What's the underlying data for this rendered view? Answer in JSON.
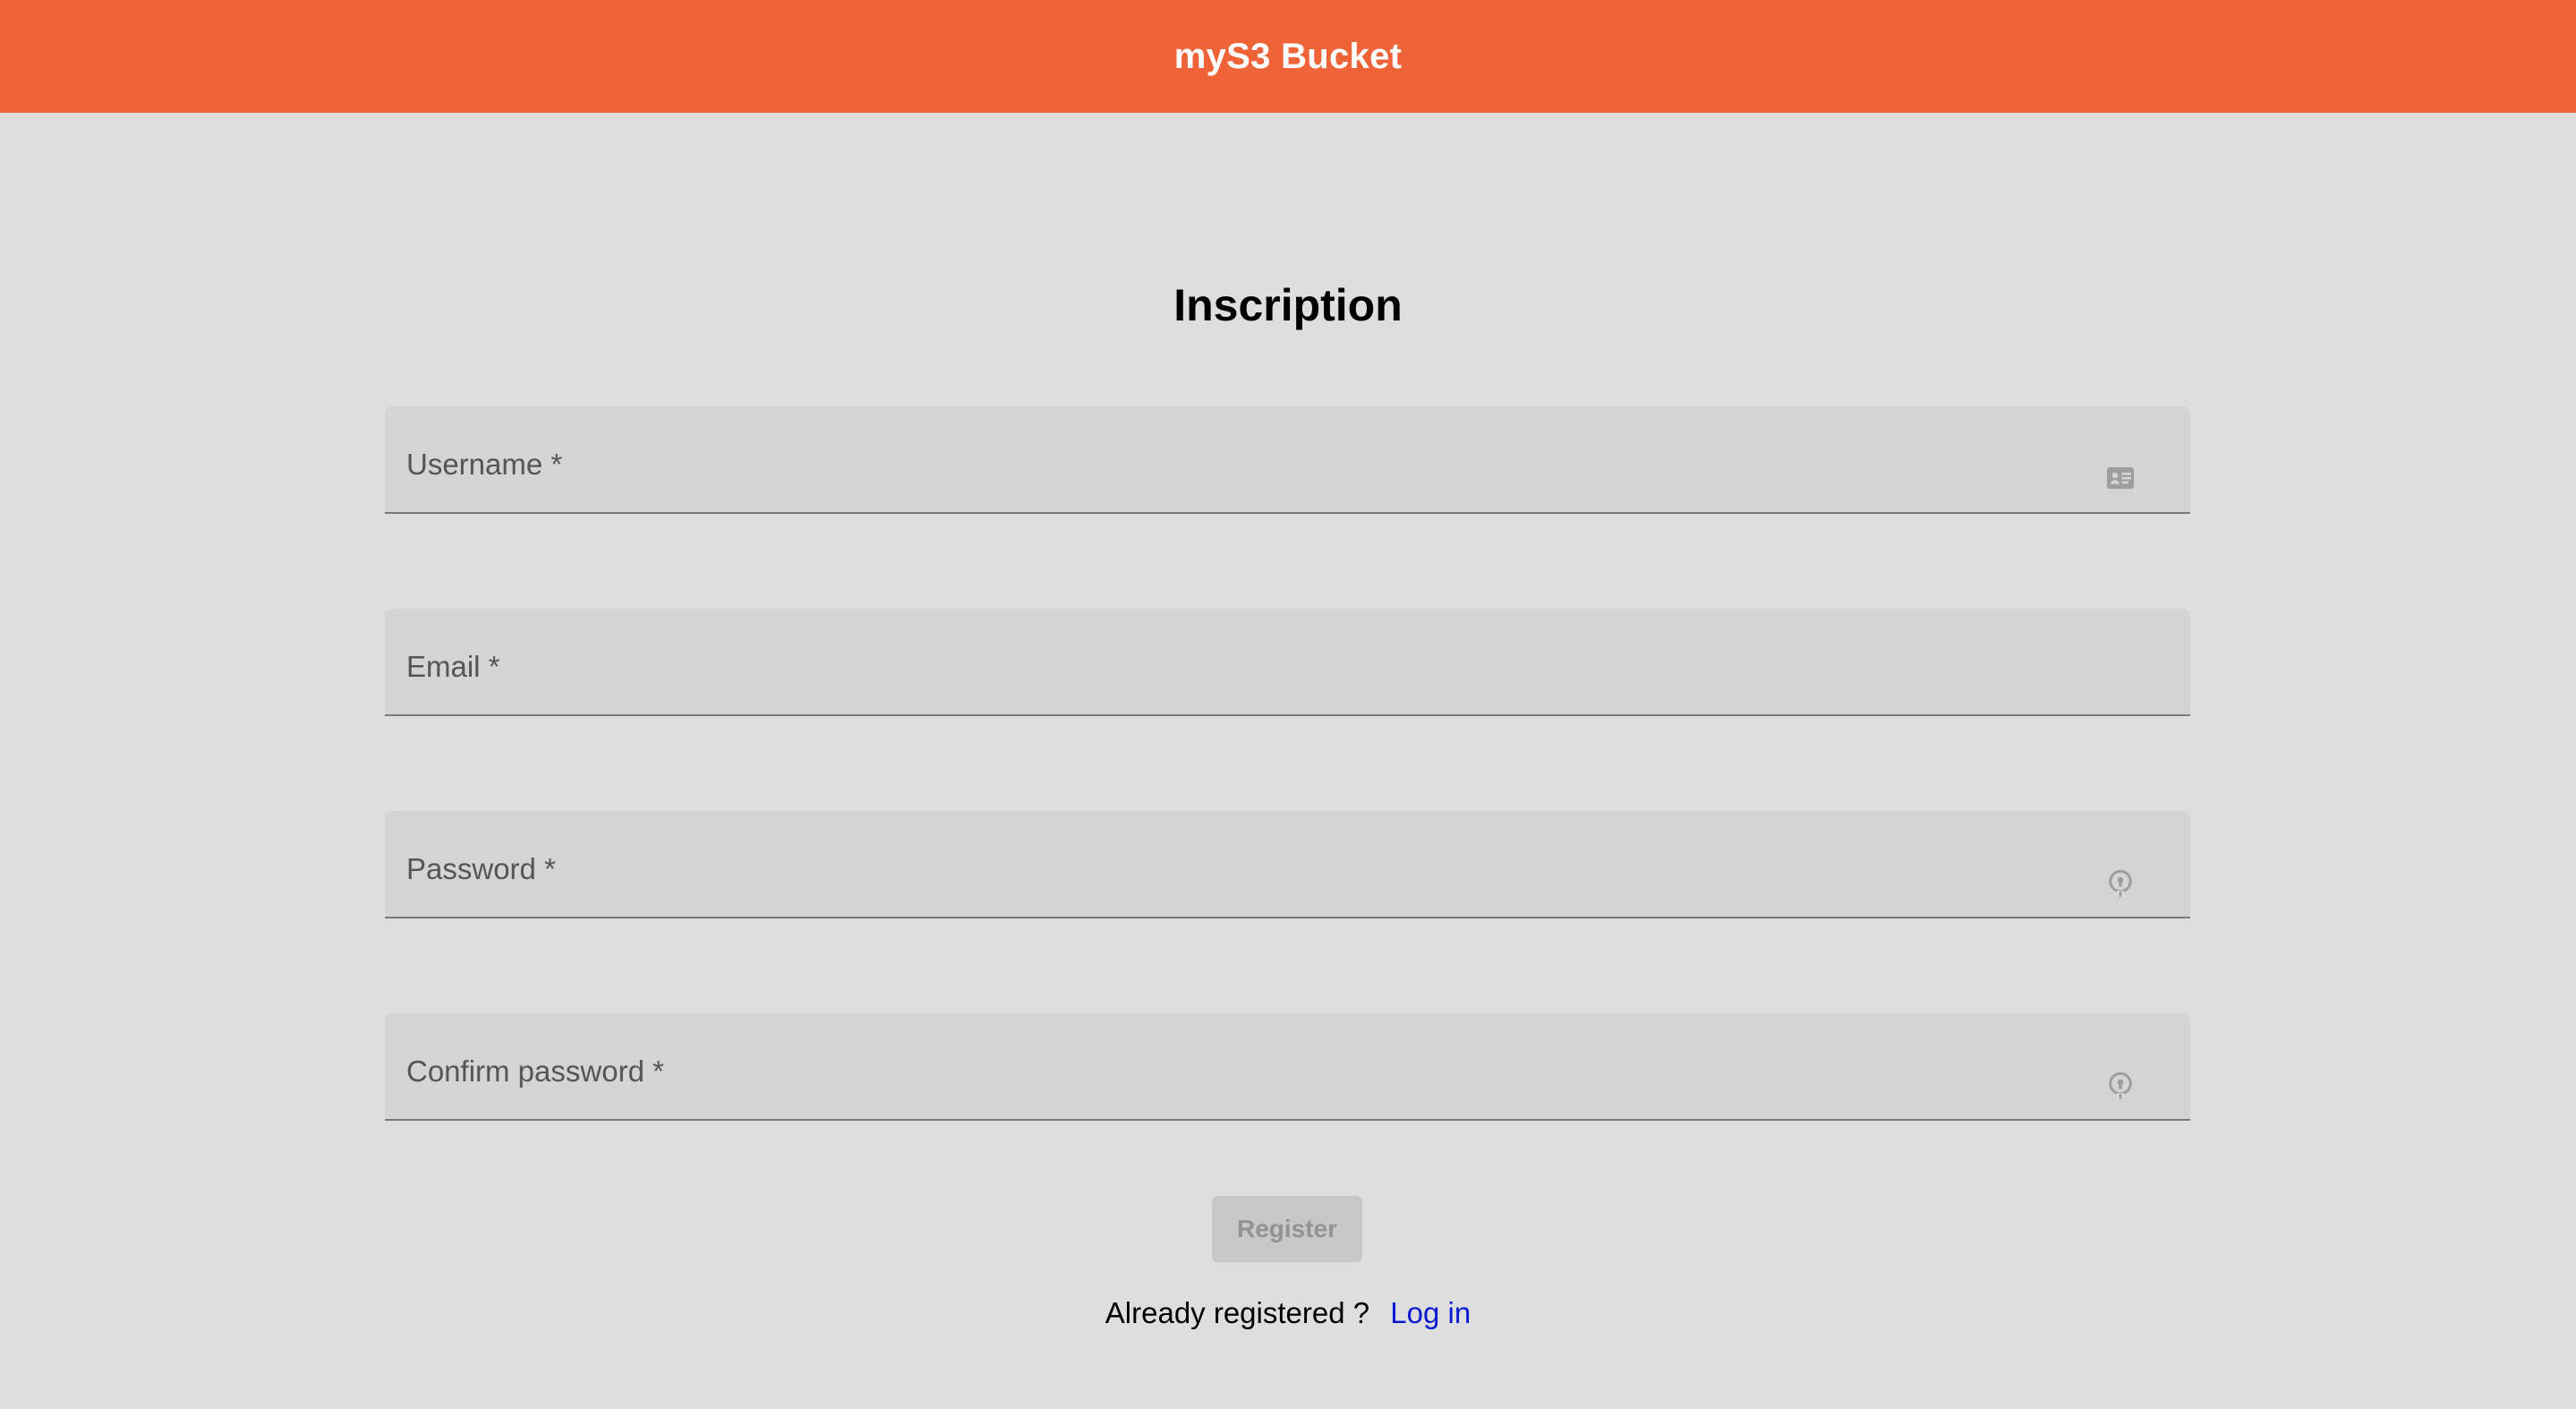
{
  "header": {
    "title": "myS3 Bucket",
    "background_color": "#ee6338"
  },
  "form": {
    "title": "Inscription",
    "fields": [
      {
        "label": "Username *",
        "value": "",
        "icon": "id-card-icon"
      },
      {
        "label": "Email *",
        "value": "",
        "icon": ""
      },
      {
        "label": "Password *",
        "value": "",
        "icon": "password-visibility-icon"
      },
      {
        "label": "Confirm password *",
        "value": "",
        "icon": "password-visibility-icon"
      }
    ],
    "submit_label": "Register",
    "submit_disabled": true
  },
  "footer": {
    "prompt": "Already registered ?",
    "link_label": "Log in",
    "link_color": "#0b1ad1"
  }
}
